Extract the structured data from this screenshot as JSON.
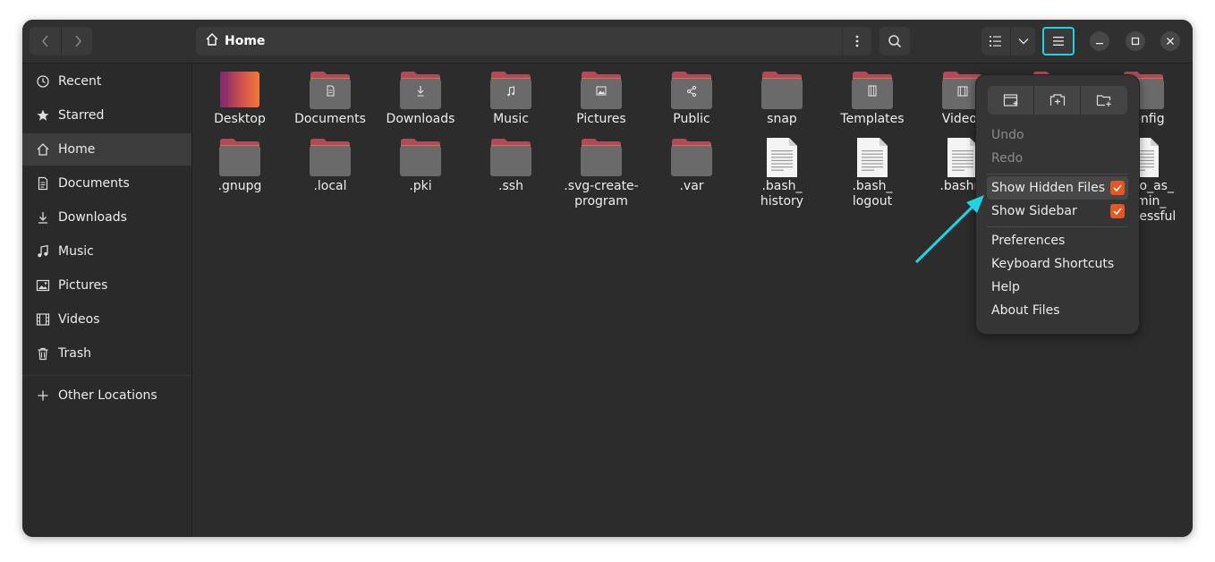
{
  "header": {
    "path_title": "Home",
    "back_icon": "chevron-left-icon",
    "forward_icon": "chevron-right-icon"
  },
  "sidebar": {
    "items": [
      {
        "label": "Recent",
        "icon": "clock-icon"
      },
      {
        "label": "Starred",
        "icon": "star-icon"
      },
      {
        "label": "Home",
        "icon": "home-icon"
      },
      {
        "label": "Documents",
        "icon": "document-icon"
      },
      {
        "label": "Downloads",
        "icon": "download-icon"
      },
      {
        "label": "Music",
        "icon": "music-icon"
      },
      {
        "label": "Pictures",
        "icon": "picture-icon"
      },
      {
        "label": "Videos",
        "icon": "film-icon"
      },
      {
        "label": "Trash",
        "icon": "trash-icon"
      }
    ],
    "other_locations": "Other Locations"
  },
  "files": {
    "row1": [
      {
        "label": "Desktop",
        "kind": "desktop"
      },
      {
        "label": "Documents",
        "kind": "folder",
        "emblem": "doc"
      },
      {
        "label": "Downloads",
        "kind": "folder",
        "emblem": "download"
      },
      {
        "label": "Music",
        "kind": "folder",
        "emblem": "music"
      },
      {
        "label": "Pictures",
        "kind": "folder",
        "emblem": "picture"
      },
      {
        "label": "Public",
        "kind": "folder",
        "emblem": "share"
      },
      {
        "label": "snap",
        "kind": "folder",
        "emblem": ""
      },
      {
        "label": "Templates",
        "kind": "folder",
        "emblem": "template"
      },
      {
        "label": "Videos",
        "kind": "folder",
        "emblem": "film"
      },
      {
        "label": "",
        "kind": "folder",
        "emblem": ""
      },
      {
        "label": ".config",
        "kind": "folder",
        "emblem": ""
      }
    ],
    "row2": [
      {
        "label": ".gnupg",
        "kind": "folder"
      },
      {
        "label": ".local",
        "kind": "folder"
      },
      {
        "label": ".pki",
        "kind": "folder"
      },
      {
        "label": ".ssh",
        "kind": "folder"
      },
      {
        "label": ".svg-create-\nprogram",
        "kind": "folder"
      },
      {
        "label": ".var",
        "kind": "folder"
      },
      {
        "label": ".bash_\nhistory",
        "kind": "text"
      },
      {
        "label": ".bash_\nlogout",
        "kind": "text"
      },
      {
        "label": ".bashrc",
        "kind": "text"
      },
      {
        "label": "",
        "kind": "none"
      },
      {
        "label": ".sudo_as_\nadmin_\nsuccessful",
        "kind": "text"
      }
    ]
  },
  "menu": {
    "top_buttons": [
      "new-window-icon",
      "new-tab-icon",
      "new-folder-icon"
    ],
    "undo": "Undo",
    "redo": "Redo",
    "show_hidden": "Show Hidden Files",
    "show_hidden_checked": true,
    "show_sidebar": "Show Sidebar",
    "show_sidebar_checked": true,
    "preferences": "Preferences",
    "shortcuts": "Keyboard Shortcuts",
    "help": "Help",
    "about": "About Files"
  },
  "colors": {
    "accent": "#e95420",
    "highlight": "#1fd3e0",
    "folder_tab": "#b34a5a",
    "folder_body": "#6a6a6a"
  }
}
